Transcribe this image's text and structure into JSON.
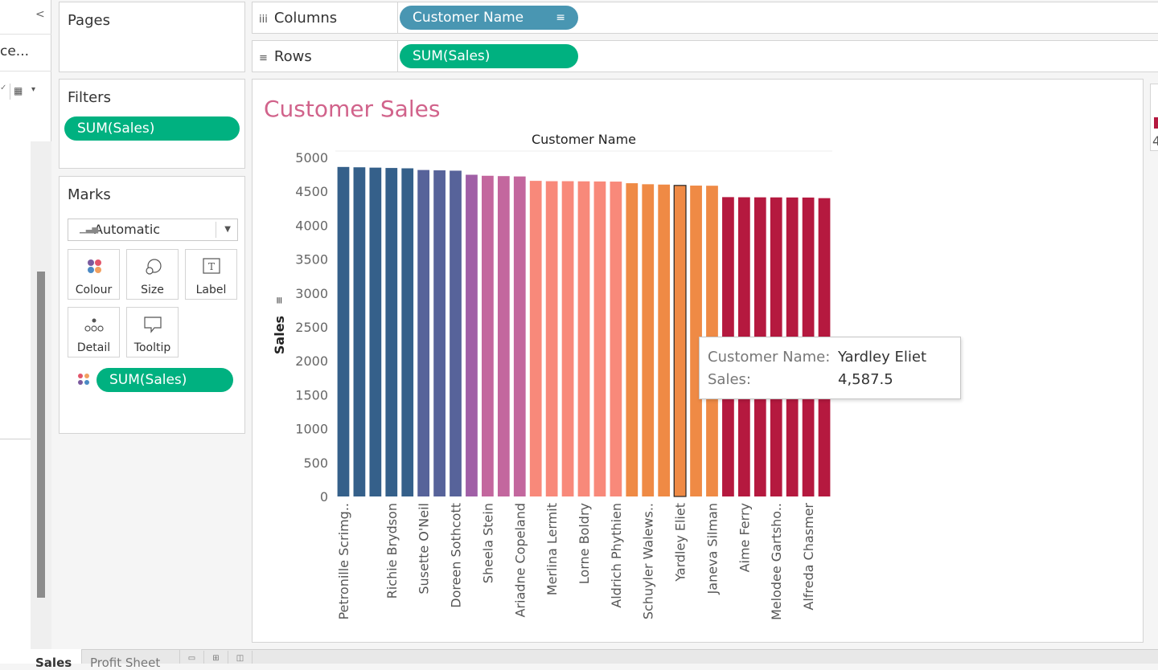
{
  "left_pane": {
    "collapse_glyph": "<",
    "truncated_source": "ce...",
    "check_glyph": "✓",
    "grid_glyph": "▦",
    "dropdown_glyph": "▾"
  },
  "pages": {
    "title": "Pages"
  },
  "filters": {
    "title": "Filters",
    "pill": "SUM(Sales)"
  },
  "marks": {
    "title": "Marks",
    "mark_type": "Automatic",
    "buttons": [
      "Colour",
      "Size",
      "Label",
      "Detail",
      "Tooltip"
    ],
    "pill": "SUM(Sales)"
  },
  "columns": {
    "label": "Columns",
    "icon_glyph": "iii",
    "pill": "Customer Name",
    "sort_glyph": "≡"
  },
  "rows": {
    "label": "Rows",
    "icon_glyph": "≡",
    "pill": "SUM(Sales)"
  },
  "view": {
    "title": "Customer Sales"
  },
  "tooltip": {
    "key1": "Customer Name:",
    "val1": "Yardley Eliet",
    "key2": "Sales:",
    "val2": "4,587.5"
  },
  "legend": {
    "visible_text": "4"
  },
  "tabs": {
    "active": "Sales",
    "second": "Profit Sheet"
  },
  "colors": {
    "accent_green": "#00b180",
    "accent_blue": "#4996b2",
    "title_pink": "#d1638b"
  },
  "chart_data": {
    "type": "bar",
    "title": "Customer Sales",
    "column_header": "Customer Name",
    "ylabel": "Sales",
    "ylim": [
      0,
      5000
    ],
    "yticks": [
      0,
      500,
      1000,
      1500,
      2000,
      2500,
      3000,
      3500,
      4000,
      4500,
      5000
    ],
    "highlighted": "Yardley Eliet",
    "bars": [
      {
        "label": "Petronille Scrimg..",
        "value": 4860,
        "color": "#35608a",
        "show_label": true
      },
      {
        "label": "",
        "value": 4855,
        "color": "#35608a",
        "show_label": false
      },
      {
        "label": "",
        "value": 4850,
        "color": "#35608a",
        "show_label": false
      },
      {
        "label": "Richie Brydson",
        "value": 4845,
        "color": "#35608a",
        "show_label": true
      },
      {
        "label": "",
        "value": 4840,
        "color": "#35608a",
        "show_label": false
      },
      {
        "label": "Susette O'Neil",
        "value": 4815,
        "color": "#57639a",
        "show_label": true
      },
      {
        "label": "",
        "value": 4810,
        "color": "#57639a",
        "show_label": false
      },
      {
        "label": "Doreen Sothcott",
        "value": 4805,
        "color": "#57639a",
        "show_label": true
      },
      {
        "label": "",
        "value": 4745,
        "color": "#a05fa6",
        "show_label": false
      },
      {
        "label": "Sheela Stein",
        "value": 4730,
        "color": "#c3679e",
        "show_label": true
      },
      {
        "label": "",
        "value": 4725,
        "color": "#c3679e",
        "show_label": false
      },
      {
        "label": "Ariadne Copeland",
        "value": 4720,
        "color": "#c3679e",
        "show_label": true
      },
      {
        "label": "",
        "value": 4655,
        "color": "#f8897a",
        "show_label": false
      },
      {
        "label": "Merlina Lermit",
        "value": 4650,
        "color": "#f8897a",
        "show_label": true
      },
      {
        "label": "",
        "value": 4650,
        "color": "#f8897a",
        "show_label": false
      },
      {
        "label": "Lorne Boldry",
        "value": 4648,
        "color": "#f8897a",
        "show_label": true
      },
      {
        "label": "",
        "value": 4646,
        "color": "#f8897a",
        "show_label": false
      },
      {
        "label": "Aldrich Phythien",
        "value": 4644,
        "color": "#f8897a",
        "show_label": true
      },
      {
        "label": "",
        "value": 4620,
        "color": "#ef8a45",
        "show_label": false
      },
      {
        "label": "Schuyler Walews..",
        "value": 4605,
        "color": "#ef8a45",
        "show_label": true
      },
      {
        "label": "",
        "value": 4600,
        "color": "#ef8a45",
        "show_label": false
      },
      {
        "label": "Yardley Eliet",
        "value": 4587.5,
        "color": "#ef8a45",
        "show_label": true
      },
      {
        "label": "",
        "value": 4585,
        "color": "#ef8a45",
        "show_label": false
      },
      {
        "label": "Janeva Silman",
        "value": 4583,
        "color": "#ef8a45",
        "show_label": true
      },
      {
        "label": "",
        "value": 4415,
        "color": "#b5193f",
        "show_label": false
      },
      {
        "label": "Aime Ferry",
        "value": 4413,
        "color": "#b5193f",
        "show_label": true
      },
      {
        "label": "",
        "value": 4412,
        "color": "#b5193f",
        "show_label": false
      },
      {
        "label": "Melodee Gartsho..",
        "value": 4411,
        "color": "#b5193f",
        "show_label": true
      },
      {
        "label": "",
        "value": 4410,
        "color": "#b5193f",
        "show_label": false
      },
      {
        "label": "Alfreda Chasmer",
        "value": 4409,
        "color": "#b5193f",
        "show_label": true
      },
      {
        "label": "",
        "value": 4400,
        "color": "#b5193f",
        "show_label": false
      }
    ]
  }
}
